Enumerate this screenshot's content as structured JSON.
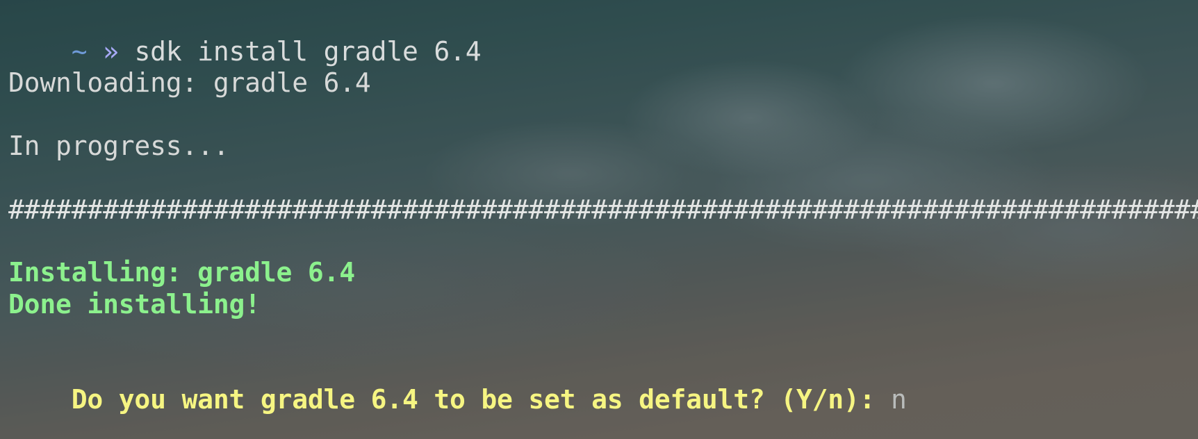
{
  "terminal": {
    "prompt": {
      "tilde": "~",
      "arrow": "»",
      "command": "sdk install gradle 6.4"
    },
    "downloading": "Downloading: gradle 6.4",
    "in_progress": "In progress...",
    "progress_bar": "#############################################################################",
    "installing": "Installing: gradle 6.4",
    "done": "Done installing!",
    "question": "Do you want gradle 6.4 to be set as default? (Y/n):",
    "answer": "n"
  },
  "colors": {
    "prompt_tilde": "#6f9ad8",
    "prompt_arrow": "#a7a9f5",
    "success_green": "#8cf18d",
    "question_yellow": "#f6f582"
  }
}
